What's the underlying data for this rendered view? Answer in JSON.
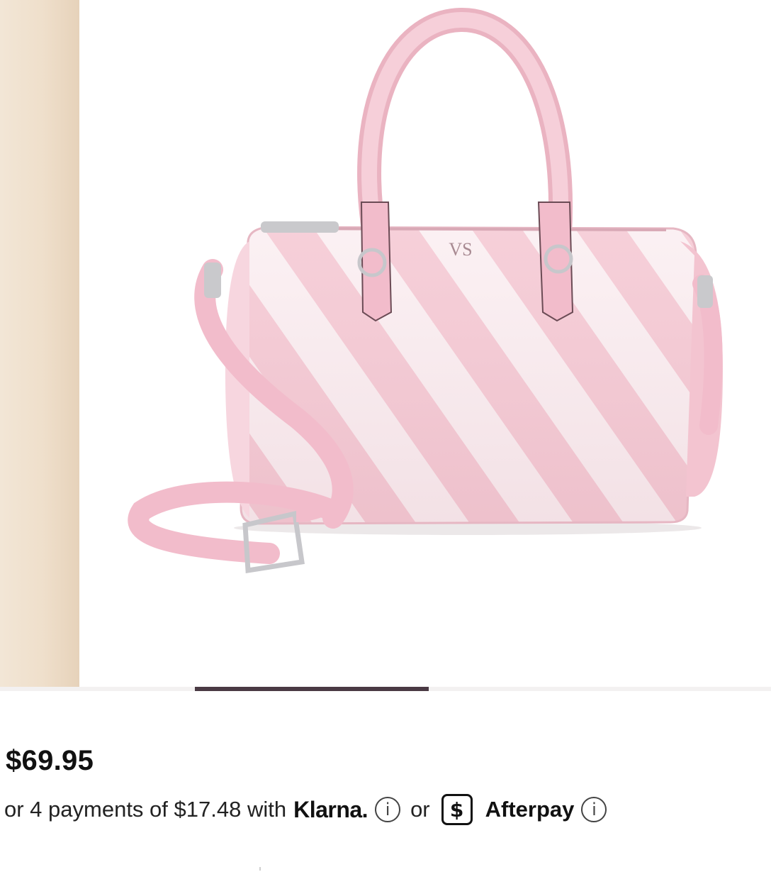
{
  "product": {
    "price": "$69.95",
    "image_alt": "Pink and white diagonal striped barrel satchel bag with top handles and crossbody strap",
    "colors": {
      "bag_pink": "#f4c9d4",
      "bag_white": "#fbeff2",
      "hardware_silver": "#c8c8c8"
    }
  },
  "carousel": {
    "progress": 0.33,
    "track_color": "#f3f1f1",
    "fill_color": "#4a3a44"
  },
  "installments": {
    "prefix": "or 4 payments of $17.48 with",
    "klarna_label": "Klarna.",
    "info_icon": "info-icon",
    "separator": "or",
    "afterpay_badge": "$",
    "afterpay_label": "Afterpay"
  }
}
